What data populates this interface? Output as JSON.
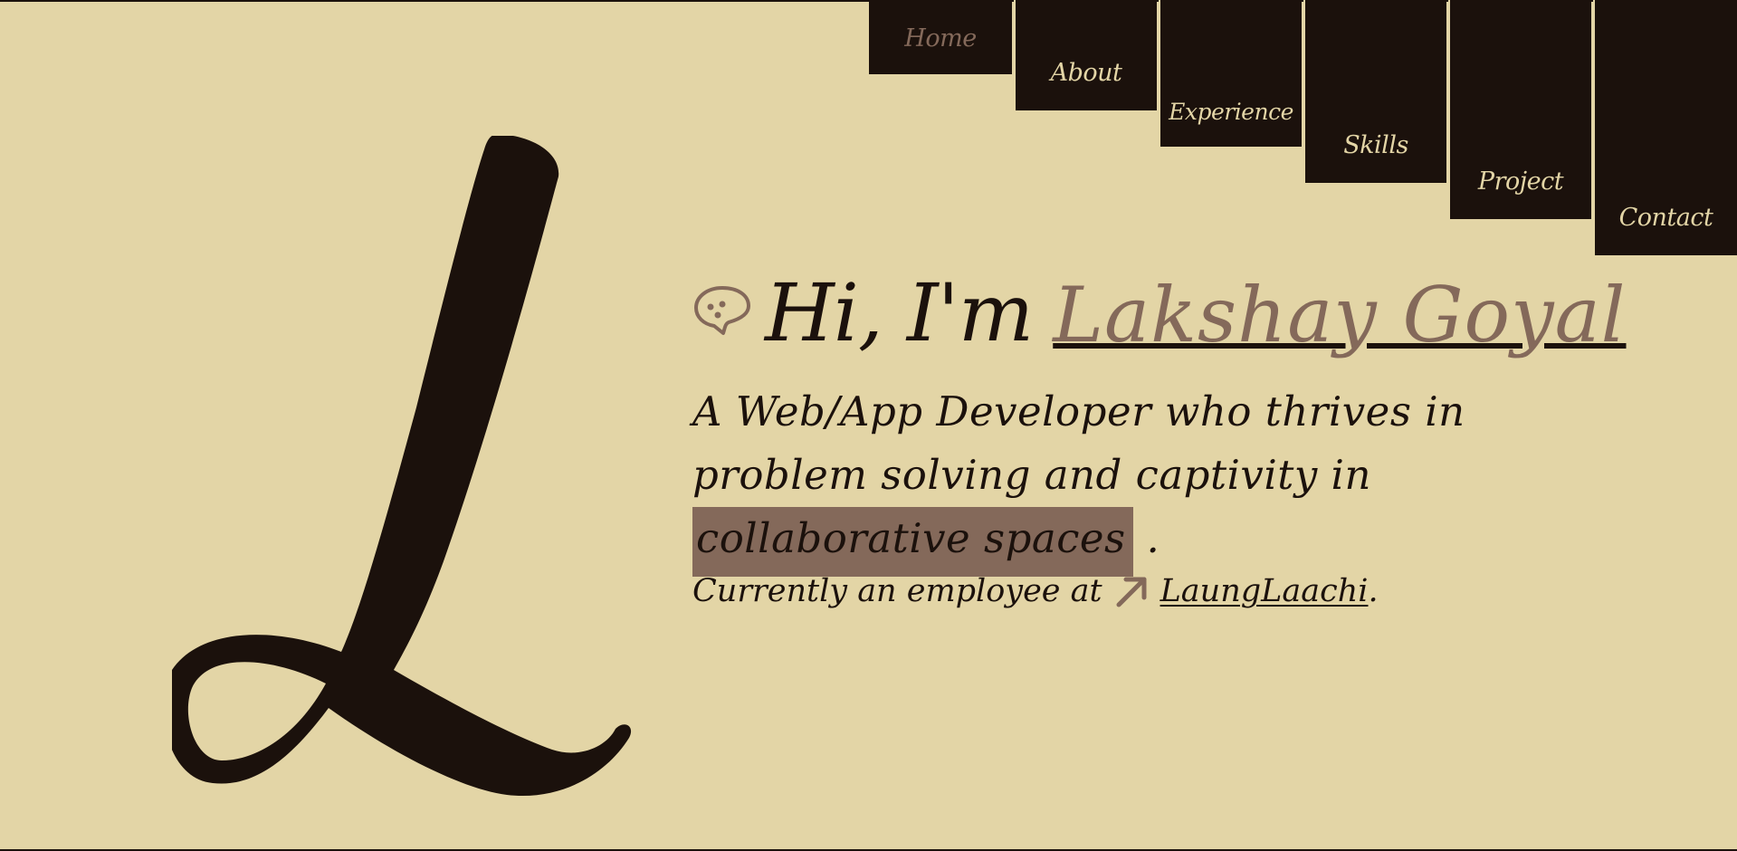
{
  "nav": {
    "items": [
      {
        "label": "Home",
        "active": true
      },
      {
        "label": "About",
        "active": false
      },
      {
        "label": "Experience",
        "active": false
      },
      {
        "label": "Skills",
        "active": false
      },
      {
        "label": "Project",
        "active": false
      },
      {
        "label": "Contact",
        "active": false
      }
    ]
  },
  "logo": {
    "icon": "letter-l-logo"
  },
  "hero": {
    "greeting_icon": "chat-bubble-icon",
    "greeting_prefix": "Hi, I'm",
    "name": "Lakshay Goyal",
    "tagline_part1": "A Web/App Developer who thrives in problem solving and captivity in",
    "tagline_highlight": "collaborative spaces",
    "tagline_end": ".",
    "employment_prefix": "Currently an employee at",
    "employment_icon": "arrow-up-right-icon",
    "company": "LaungLaachi",
    "employment_suffix": "."
  },
  "colors": {
    "background": "#e3d5a6",
    "dark": "#1b110c",
    "accent": "#84695a"
  }
}
